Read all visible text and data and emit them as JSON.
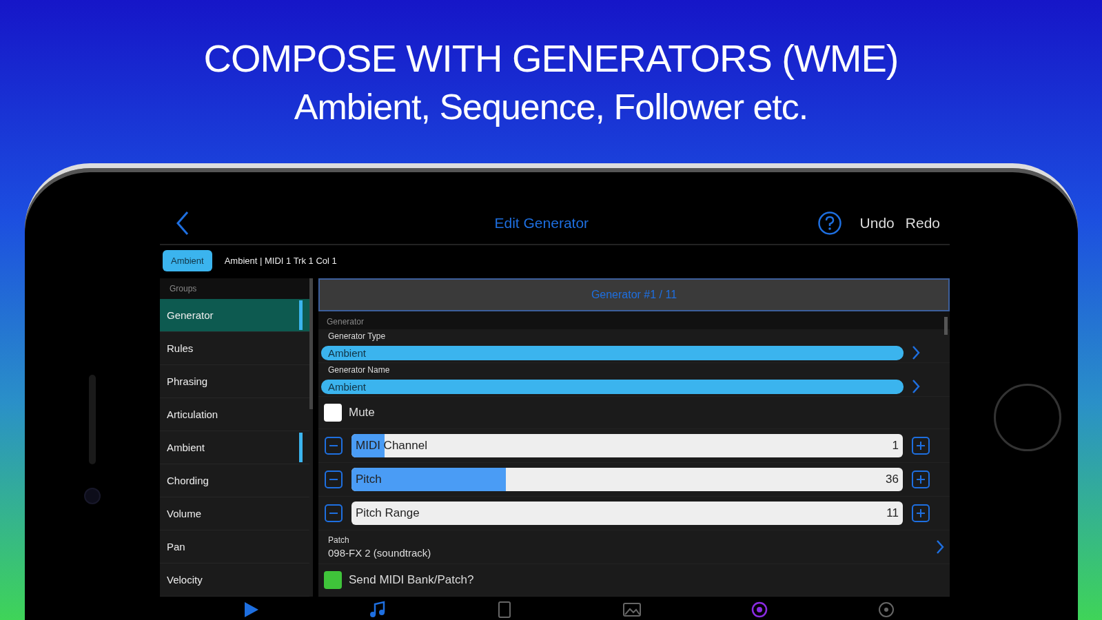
{
  "headline": [
    "COMPOSE WITH GENERATORS (WME)",
    "Ambient, Sequence, Follower etc."
  ],
  "nav": {
    "title": "Edit Generator",
    "actions": [
      "Undo",
      "Redo"
    ]
  },
  "breadcrumb": {
    "tag": "Ambient",
    "path": "Ambient | MIDI 1 Trk 1 Col 1"
  },
  "sidebar": {
    "header": "Groups",
    "items": [
      {
        "label": "Generator",
        "selected": true,
        "indicator": true
      },
      {
        "label": "Rules",
        "selected": false,
        "indicator": false
      },
      {
        "label": "Phrasing",
        "selected": false,
        "indicator": false
      },
      {
        "label": "Articulation",
        "selected": false,
        "indicator": false
      },
      {
        "label": "Ambient",
        "selected": false,
        "indicator": true
      },
      {
        "label": "Chording",
        "selected": false,
        "indicator": false
      },
      {
        "label": "Volume",
        "selected": false,
        "indicator": false
      },
      {
        "label": "Pan",
        "selected": false,
        "indicator": false
      },
      {
        "label": "Velocity",
        "selected": false,
        "indicator": false
      }
    ]
  },
  "panel": {
    "title": "Generator #1 / 11",
    "section": "Generator",
    "rows": [
      {
        "kind": "select",
        "label": "Generator Type",
        "value": "Ambient"
      },
      {
        "kind": "select",
        "label": "Generator Name",
        "value": "Ambient"
      },
      {
        "kind": "checkbox",
        "label": "Mute",
        "checked": false
      },
      {
        "kind": "slider",
        "label": "MIDI Channel",
        "value": "1",
        "level": 0.06
      },
      {
        "kind": "slider",
        "label": "Pitch",
        "value": "36",
        "level": 0.28
      },
      {
        "kind": "slider",
        "label": "Pitch Range",
        "value": "11"
      },
      {
        "kind": "link",
        "label": "Patch",
        "value": "098-FX 2 (soundtrack)"
      },
      {
        "kind": "checkbox",
        "label": "Send MIDI Bank/Patch?",
        "checked": true
      }
    ]
  }
}
